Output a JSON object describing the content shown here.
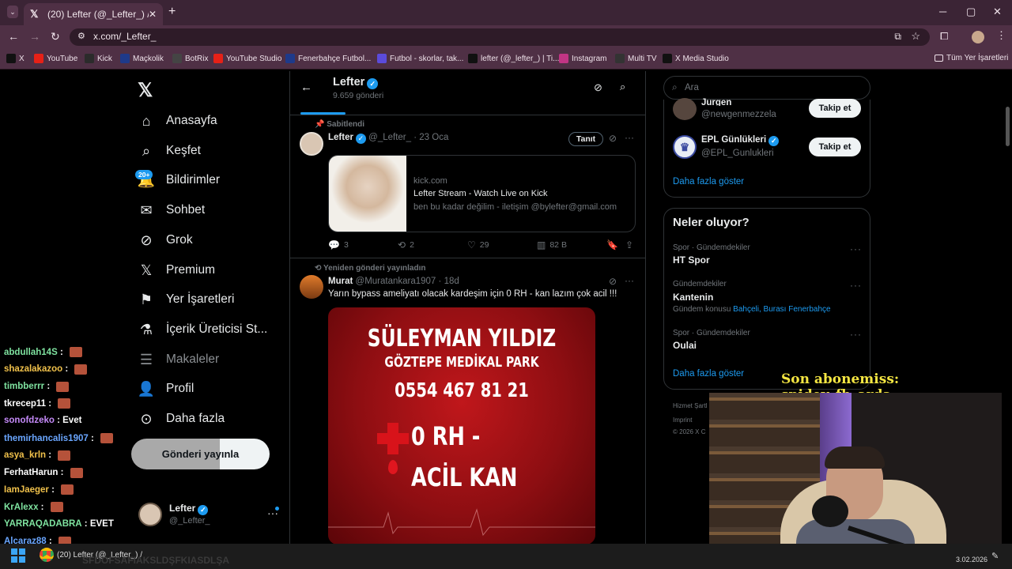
{
  "browser": {
    "tab_title": "(20) Lefter (@_Lefter_) / X",
    "tab_close": "✕",
    "new_tab": "+",
    "url": "x.com/_Lefter_",
    "window_controls": [
      "─",
      "▢",
      "✕"
    ],
    "bookmarks": [
      {
        "label": "X",
        "color": "#111111",
        "icon": "x-icon"
      },
      {
        "label": "YouTube",
        "color": "#e62117",
        "icon": "youtube-icon"
      },
      {
        "label": "Kick",
        "color": "#2b2b2b",
        "icon": "kick-icon"
      },
      {
        "label": "Maçkolik",
        "color": "#1e3a8a",
        "icon": "mackolik-icon"
      },
      {
        "label": "BotRix",
        "color": "#444444",
        "icon": "botrix-icon"
      },
      {
        "label": "YouTube Studio",
        "color": "#e62117",
        "icon": "youtube-studio-icon"
      },
      {
        "label": "Fenerbahçe Futbol...",
        "color": "#1e3a8a",
        "icon": "fenerbahce-icon"
      },
      {
        "label": "Futbol - skorlar, tak...",
        "color": "#5b4bdb",
        "icon": "futbol-icon"
      },
      {
        "label": "lefter (@_lefter_) | Ti...",
        "color": "#111111",
        "icon": "tiktok-icon"
      },
      {
        "label": "Instagram",
        "color": "#c13584",
        "icon": "instagram-icon"
      },
      {
        "label": "Multi TV",
        "color": "#333333",
        "icon": "multitv-icon"
      },
      {
        "label": "X Media Studio",
        "color": "#111111",
        "icon": "x-media-icon"
      }
    ],
    "all_bookmarks": "Tüm Yer İşaretleri"
  },
  "nav": {
    "items": [
      {
        "label": "Anasayfa",
        "icon": "home-icon"
      },
      {
        "label": "Keşfet",
        "icon": "search-icon"
      },
      {
        "label": "Bildirimler",
        "icon": "bell-icon"
      },
      {
        "label": "Sohbet",
        "icon": "mail-icon"
      },
      {
        "label": "Grok",
        "icon": "grok-icon"
      },
      {
        "label": "Premium",
        "icon": "x-icon"
      },
      {
        "label": "Yer İşaretleri",
        "icon": "bookmark-icon"
      },
      {
        "label": "İçerik Üreticisi St...",
        "icon": "flask-icon"
      },
      {
        "label": "Makaleler",
        "icon": "article-icon"
      },
      {
        "label": "Profil",
        "icon": "person-icon"
      },
      {
        "label": "Daha fazla",
        "icon": "more-icon"
      }
    ],
    "notification_badge": "20+",
    "post_button": "Gönderi yayınla",
    "account": {
      "name": "Lefter",
      "handle": "@_Lefter_"
    }
  },
  "profile_header": {
    "name": "Lefter",
    "posts": "9.659 gönderi"
  },
  "tweets": [
    {
      "context": "Sabitlendi",
      "name": "Lefter",
      "handle": "@_Lefter_",
      "date": "· 23 Oca",
      "promote": "Tanıt",
      "card": {
        "domain": "kick.com",
        "title": "Lefter Stream - Watch Live on Kick",
        "desc": "ben bu kadar değilim - iletişim @bylefter@gmail.com"
      },
      "stats": {
        "replies": "3",
        "reposts": "2",
        "likes": "29",
        "views": "82 B"
      }
    },
    {
      "context": "Yeniden gönderi yayınladın",
      "name": "Murat",
      "handle": "@Muratankara1907",
      "date": "· 18d",
      "text": "Yarın bypass ameliyatı olacak kardeşim için 0 RH - kan lazım çok acil !!!",
      "poster": {
        "line1": "SÜLEYMAN YILDIZ",
        "line2": "GÖZTEPE MEDİKAL PARK",
        "line3": "0554 467 81 21",
        "line4": "0 RH -",
        "line5": "ACİL KAN"
      }
    }
  ],
  "sidebar": {
    "search_placeholder": "Ara",
    "who_to_follow": [
      {
        "name": "Jurgen",
        "handle": "@newgenmezzela",
        "button": "Takip et"
      },
      {
        "name": "EPL Günlükleri",
        "handle": "@EPL_Gunlukleri",
        "button": "Takip et"
      }
    ],
    "show_more": "Daha fazla göster",
    "trends_title": "Neler oluyor?",
    "trends": [
      {
        "meta": "Spor · Gündemdekiler",
        "name": "HT Spor",
        "extra": ""
      },
      {
        "meta": "Gündemdekiler",
        "name": "Kantenin",
        "extra": "Gündem konusu",
        "links": "Bahçeli, Burası Fenerbahçe"
      },
      {
        "meta": "Spor · Gündemdekiler",
        "name": "Oulai",
        "extra": ""
      }
    ],
    "show_more_2": "Daha fazla göster",
    "footer": [
      "Hizmet Şartl",
      "Imprint",
      "© 2026 X C"
    ]
  },
  "overlay": {
    "last_sub": "Son abonemiss: spidey_fb_arda",
    "chat": [
      {
        "user": "abdullah14S",
        "color": "#7fe3a0",
        "msg": "",
        "emote": true
      },
      {
        "user": "shazalakazoo",
        "color": "#f0c14b",
        "msg": "",
        "emote": true
      },
      {
        "user": "timbberrr",
        "color": "#7fe3a0",
        "msg": "",
        "emote": true
      },
      {
        "user": "tkrecep11",
        "color": "#ffffff",
        "msg": "",
        "emote": true
      },
      {
        "user": "sonofdzeko",
        "color": "#c58af9",
        "msg": "Evet",
        "emote": false
      },
      {
        "user": "themirhancalis1907",
        "color": "#6aa6ff",
        "msg": "",
        "emote": true
      },
      {
        "user": "asya_krln",
        "color": "#f0c14b",
        "msg": "",
        "emote": true
      },
      {
        "user": "FerhatHarun",
        "color": "#ffffff",
        "msg": "",
        "emote": true
      },
      {
        "user": "IamJaeger",
        "color": "#f0c14b",
        "msg": "",
        "emote": true
      },
      {
        "user": "KrAlexx",
        "color": "#7fe3a0",
        "msg": "",
        "emote": true
      },
      {
        "user": "YARRAQADABRA",
        "color": "#7fe3a0",
        "msg": "EVET",
        "emote": false
      },
      {
        "user": "Alcaraz88",
        "color": "#6aa6ff",
        "msg": "",
        "emote": true
      }
    ],
    "ticker": "SFDOFSAFIAKSLDŞFKIASDLŞA"
  },
  "taskbar": {
    "app_title": "(20) Lefter (@_Lefter_) /",
    "date": "3.02.2026"
  },
  "colors": {
    "accent": "#1d9bf0",
    "chrome": "#4f3045",
    "tabstrip": "#3b2435"
  }
}
